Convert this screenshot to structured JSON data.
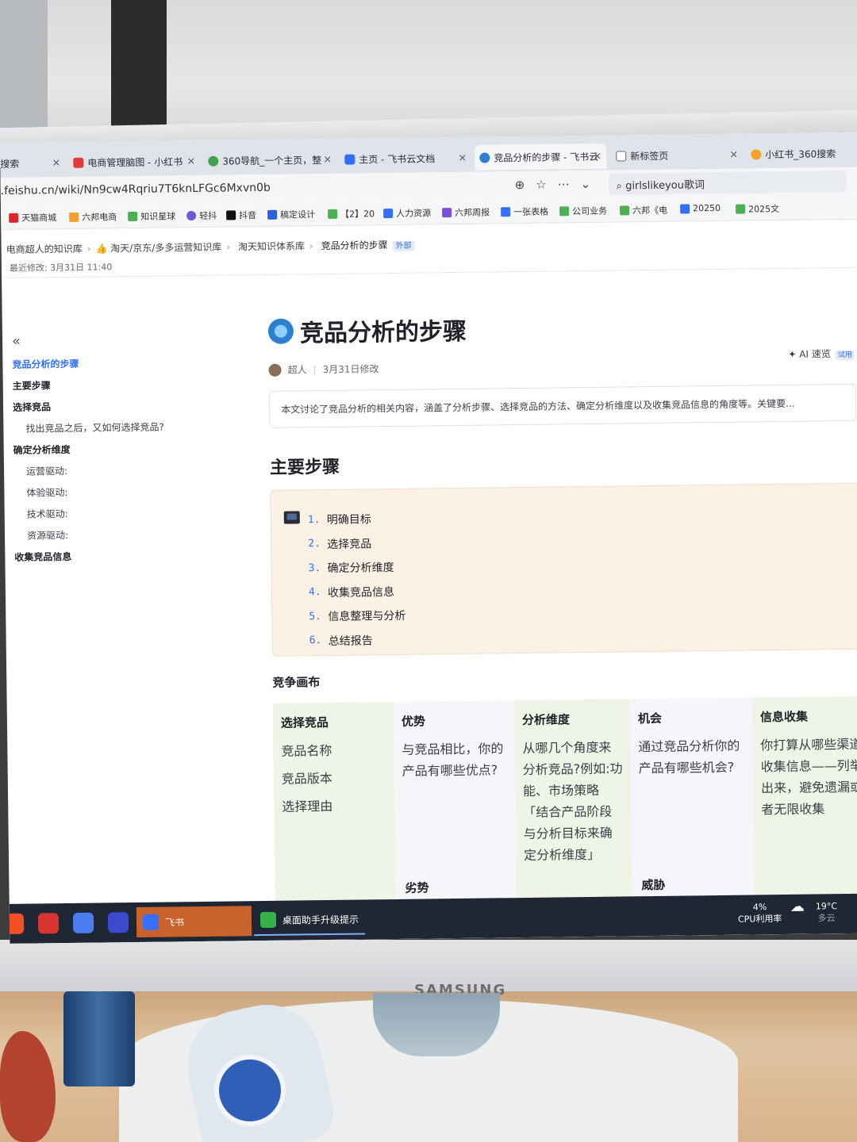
{
  "browser": {
    "tabs": [
      {
        "label": "搜索",
        "close": "×"
      },
      {
        "label": "电商管理脑图 - 小红书",
        "close": "×"
      },
      {
        "label": "360导航_一个主页，整",
        "close": "×"
      },
      {
        "label": "主页 - 飞书云文档",
        "close": "×"
      },
      {
        "label": "竞品分析的步骤 - 飞书云",
        "close": "×"
      },
      {
        "label": "新标签页",
        "close": "×"
      },
      {
        "label": "小红书_360搜索",
        "close": ""
      }
    ],
    "url": ".feishu.cn/wiki/Nn9cw4Rqriu7T6knLFGc6Mxvn0b",
    "search_value": "girlslikeyou歌词",
    "bookmarks": [
      "天猫商城",
      "六邦电商",
      "知识星球",
      "轻抖",
      "抖音",
      "稿定设计",
      "【2】20",
      "人力资源",
      "六邦周报",
      "一张表格",
      "公司业务",
      "六邦《电",
      "20250",
      "2025文"
    ]
  },
  "doc": {
    "breadcrumb": [
      "电商超人的知识库",
      "淘天/京东/多多运营知识库",
      "淘天知识体系库",
      "竞品分析的步骤"
    ],
    "breadcrumb_tag": "外部",
    "last_modified": "最近修改: 3月31日 11:40",
    "title": "竞品分析的步骤",
    "author": "超人",
    "modified": "3月31日修改",
    "ai_label": "AI 速览",
    "ai_trial": "试用",
    "summary": "本文讨论了竞品分析的相关内容，涵盖了分析步骤、选择竞品的方法、确定分析维度以及收集竞品信息的角度等。关键要...",
    "section_title": "主要步骤",
    "steps": [
      {
        "num": "1.",
        "text": "明确目标"
      },
      {
        "num": "2.",
        "text": "选择竞品"
      },
      {
        "num": "3.",
        "text": "确定分析维度"
      },
      {
        "num": "4.",
        "text": "收集竞品信息"
      },
      {
        "num": "5.",
        "text": "信息整理与分析"
      },
      {
        "num": "6.",
        "text": "总结报告"
      }
    ],
    "canvas_title": "竞争画布",
    "canvas": {
      "c1": {
        "title": "选择竞品",
        "lines": [
          "竞品名称",
          "竞品版本",
          "选择理由"
        ]
      },
      "c2": {
        "title": "优势",
        "text": "与竞品相比，你的产品有哪些优点?",
        "sub": "劣势"
      },
      "c3": {
        "title": "分析维度",
        "text": "从哪几个角度来分析竞品?例如:功能、市场策略「结合产品阶段与分析目标来确定分析维度」"
      },
      "c4": {
        "title": "机会",
        "text": "通过竞品分析你的产品有哪些机会?",
        "sub": "威胁"
      },
      "c5": {
        "title": "信息收集",
        "text": "你打算从哪些渠道收集信息——列举出来，避免遗漏或者无限收集"
      }
    }
  },
  "toc": {
    "collapse": "«",
    "items": [
      {
        "label": "竞品分析的步骤",
        "level": 0
      },
      {
        "label": "主要步骤",
        "level": 1
      },
      {
        "label": "选择竞品",
        "level": 1
      },
      {
        "label": "找出竞品之后，又如何选择竞品?",
        "level": 2
      },
      {
        "label": "确定分析维度",
        "level": 1
      },
      {
        "label": "运营驱动:",
        "level": 2
      },
      {
        "label": "体验驱动:",
        "level": 2
      },
      {
        "label": "技术驱动:",
        "level": 2
      },
      {
        "label": "资源驱动:",
        "level": 2
      },
      {
        "label": "收集竞品信息",
        "level": 1
      }
    ]
  },
  "taskbar": {
    "feishu_label": "飞书",
    "helper_label": "桌面助手升级提示",
    "cpu_value": "4%",
    "cpu_label": "CPU利用率",
    "temp": "19°C",
    "weather": "多云"
  },
  "monitor_brand": "SAMSUNG"
}
